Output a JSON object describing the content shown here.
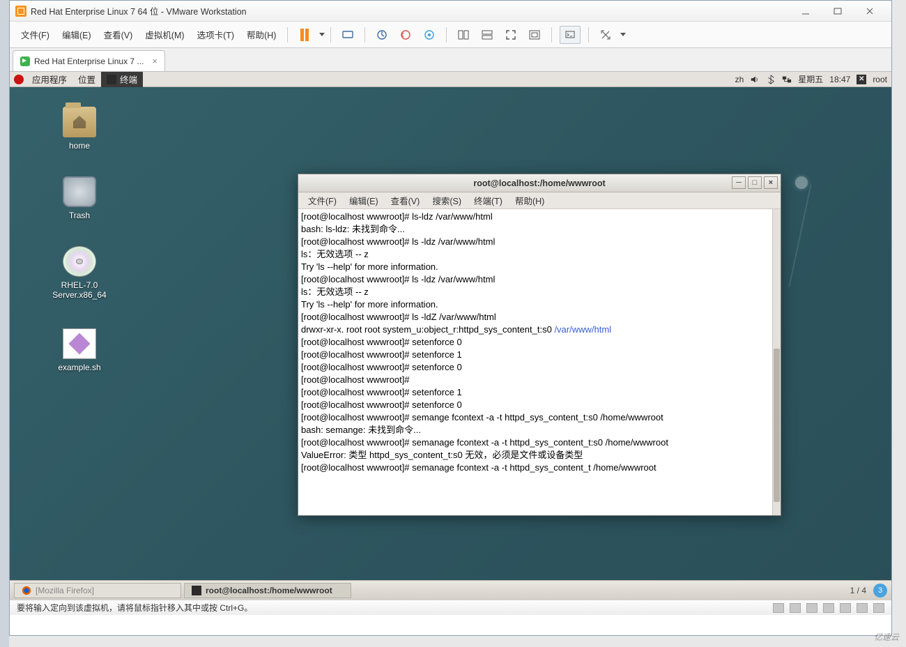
{
  "vmware": {
    "title": "Red Hat Enterprise Linux 7 64 位 - VMware Workstation",
    "menu": [
      "文件(F)",
      "编辑(E)",
      "查看(V)",
      "虚拟机(M)",
      "选项卡(T)",
      "帮助(H)"
    ],
    "tab": "Red Hat Enterprise Linux 7 ...",
    "status": "要将输入定向到该虚拟机，请将鼠标指针移入其中或按 Ctrl+G。"
  },
  "gnome": {
    "apps": "应用程序",
    "places": "位置",
    "active_app": "终端",
    "ime": "zh",
    "day": "星期五",
    "time": "18:47",
    "user": "root"
  },
  "desktop": {
    "home": "home",
    "trash": "Trash",
    "cd": "RHEL-7.0 Server.x86_64",
    "script": "example.sh"
  },
  "terminal": {
    "title": "root@localhost:/home/wwwroot",
    "menu": [
      "文件(F)",
      "编辑(E)",
      "查看(V)",
      "搜索(S)",
      "终端(T)",
      "帮助(H)"
    ],
    "lines": [
      "[root@localhost wwwroot]#  ls-ldz /var/www/html",
      "bash: ls-ldz: 未找到命令...",
      "[root@localhost wwwroot]#  ls -ldz /var/www/html",
      "ls：无效选项 -- z",
      "Try 'ls --help' for more information.",
      "[root@localhost wwwroot]# ls -ldz /var/www/html",
      "ls：无效选项 -- z",
      "Try 'ls --help' for more information.",
      "[root@localhost wwwroot]# ls -ldZ /var/www/html",
      "drwxr-xr-x. root root system_u:object_r:httpd_sys_content_t:s0 ",
      "[root@localhost wwwroot]#  setenforce 0",
      "[root@localhost wwwroot]#  setenforce 1",
      "[root@localhost wwwroot]#  setenforce 0",
      "[root@localhost wwwroot]#",
      "[root@localhost wwwroot]#  setenforce 1",
      "[root@localhost wwwroot]#  setenforce 0",
      "[root@localhost wwwroot]#  semange fcontext -a -t httpd_sys_content_t:s0 /home/wwwroot",
      "bash: semange: 未找到命令...",
      "[root@localhost wwwroot]#  semanage fcontext -a -t httpd_sys_content_t:s0 /home/wwwroot",
      "ValueError: 类型 httpd_sys_content_t:s0 无效，必须是文件或设备类型",
      "[root@localhost wwwroot]#  semanage fcontext -a -t httpd_sys_content_t /home/wwwroot"
    ],
    "path_highlight": "/var/www/html"
  },
  "taskbar": {
    "firefox": "[Mozilla Firefox]",
    "term": "root@localhost:/home/wwwroot",
    "pager": "1 / 4",
    "badge": "3"
  },
  "watermark": "亿速云"
}
